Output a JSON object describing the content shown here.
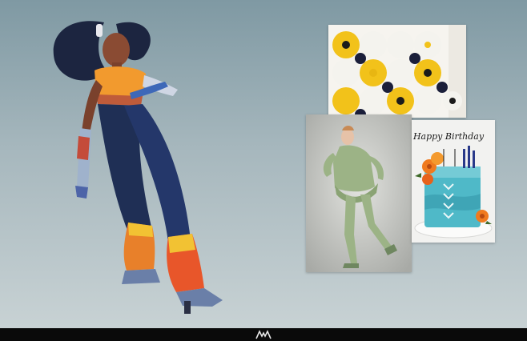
{
  "board": {
    "background_top": "#7f99a3",
    "background_bottom": "#c8d2d4",
    "bottom_bar_color": "#0a0a0a"
  },
  "items": [
    {
      "kind": "illustration",
      "icon": "character-illustration"
    },
    {
      "kind": "photo",
      "icon": "cupcakes-photo"
    },
    {
      "kind": "photo",
      "icon": "fashion-model-photo"
    },
    {
      "kind": "photo",
      "icon": "birthday-cake-photo"
    }
  ],
  "cake": {
    "topper_text": "Happy Birthday"
  },
  "colors": {
    "outfit_orange": "#f29a2e",
    "outfit_navy": "#1f2f55",
    "hair": "#1c2540",
    "cupcake_yellow": "#f2c21a",
    "cake_blue": "#4fb9c8",
    "rose_orange": "#f07a1e",
    "lace_green": "#9cb386"
  }
}
